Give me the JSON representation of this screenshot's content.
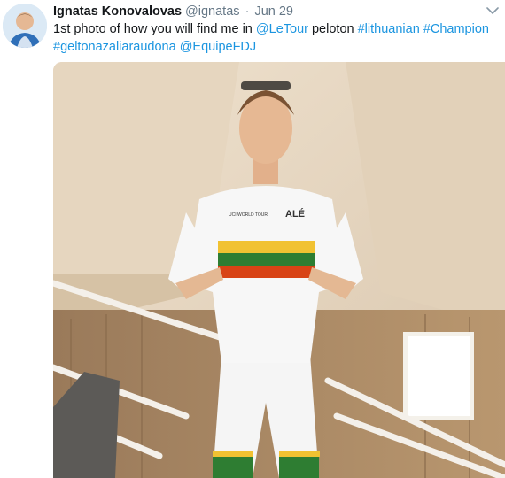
{
  "tweet": {
    "author_name": "Ignatas Konovalovas",
    "author_handle": "@ignatas",
    "separator": "·",
    "date": "Jun 29",
    "text_parts": [
      {
        "text": "1st photo of how you will find me in ",
        "link": false
      },
      {
        "text": "@LeTour",
        "link": true
      },
      {
        "text": " peloton ",
        "link": false
      },
      {
        "text": "#lithuanian",
        "link": true
      },
      {
        "text": " ",
        "link": false
      },
      {
        "text": "#Champion",
        "link": true
      },
      {
        "text": " ",
        "link": false
      },
      {
        "text": "#geltonazaliaraudona",
        "link": true
      },
      {
        "text": " ",
        "link": false
      },
      {
        "text": "@EquipeFDJ",
        "link": true
      }
    ],
    "menu_icon": "chevron-down-icon",
    "photo": {
      "jersey_sponsor": "ALÉ",
      "jersey_badge": "UCI WORLD TOUR",
      "flag_colors": [
        "#f1c232",
        "#2e7d32",
        "#d84315"
      ]
    }
  },
  "colors": {
    "link": "#1b95e0",
    "name": "#14171a",
    "muted": "#657786"
  }
}
